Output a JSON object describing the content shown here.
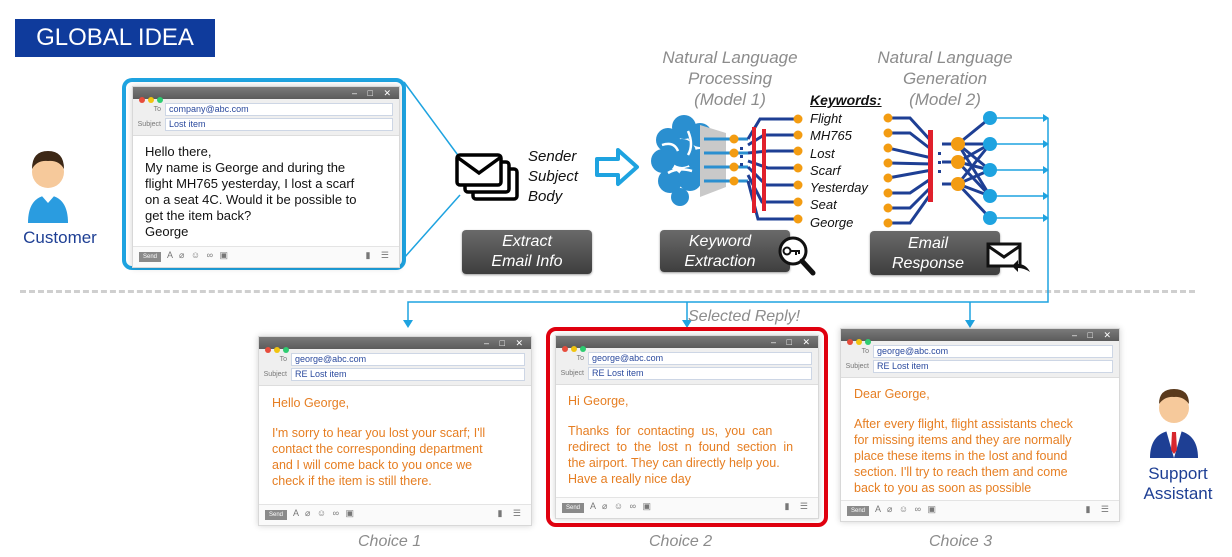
{
  "title": "GLOBAL IDEA",
  "customer": {
    "label": "Customer"
  },
  "support": {
    "line1": "Support",
    "line2": "Assistant"
  },
  "customer_email": {
    "to": "company@abc.com",
    "subject": "Lost item",
    "to_label": "To",
    "subject_label": "Subject",
    "send_label": "Send",
    "body_lines": [
      "Hello there,",
      "My name is George and during the",
      "flight MH765 yesterday, I lost a scarf",
      "on a seat 4C. Would it be possible to",
      "get the item back?",
      "George"
    ]
  },
  "email_info": {
    "lines": [
      "Sender",
      "Subject",
      "Body"
    ],
    "button_line1": "Extract",
    "button_line2": "Email Info"
  },
  "nlp": {
    "line1": "Natural Language",
    "line2": "Processing",
    "line3": "(Model 1)",
    "button_line1": "Keyword",
    "button_line2": "Extraction"
  },
  "keywords": {
    "title": "Keywords:",
    "items": [
      "Flight",
      "MH765",
      "Lost",
      "Scarf",
      "Yesterday",
      "Seat",
      "George"
    ]
  },
  "nlg": {
    "line1": "Natural Language",
    "line2": "Generation",
    "line3": "(Model 2)",
    "button_line1": "Email",
    "button_line2": "Response"
  },
  "selected_label": "Selected Reply!",
  "choices": [
    {
      "label": "Choice 1",
      "to": "george@abc.com",
      "subject": "RE Lost item",
      "body_lines": [
        "Hello George,",
        "",
        "I'm sorry to hear you lost your scarf; I'll",
        "contact the corresponding department",
        "and I will come back to you once we",
        "check if the item is still there."
      ]
    },
    {
      "label": "Choice 2",
      "to": "george@abc.com",
      "subject": "RE Lost item",
      "body_lines": [
        "Hi George,",
        "",
        "Thanks  for  contacting  us,  you  can",
        "redirect  to  the  lost  n  found  section  in",
        "the airport. They can directly help you.",
        "Have a really nice day"
      ]
    },
    {
      "label": "Choice 3",
      "to": "george@abc.com",
      "subject": "RE Lost item",
      "body_lines": [
        "Dear George,",
        "",
        "After every flight, flight assistants check",
        "for missing items and they are normally",
        "place these items in the lost and found",
        "section. I'll try to reach them and come",
        "back to you as soon as possible"
      ]
    }
  ],
  "colors": {
    "title_bg": "#0f3b9c",
    "accent_blue": "#1ea3e0",
    "selected_red": "#e0000f",
    "reply_text": "#e67e22"
  },
  "icons": [
    "person-icon",
    "envelope-stack-icon",
    "brain-circuit-icon",
    "key-search-icon",
    "envelope-reply-icon",
    "arrow-right-icon"
  ]
}
